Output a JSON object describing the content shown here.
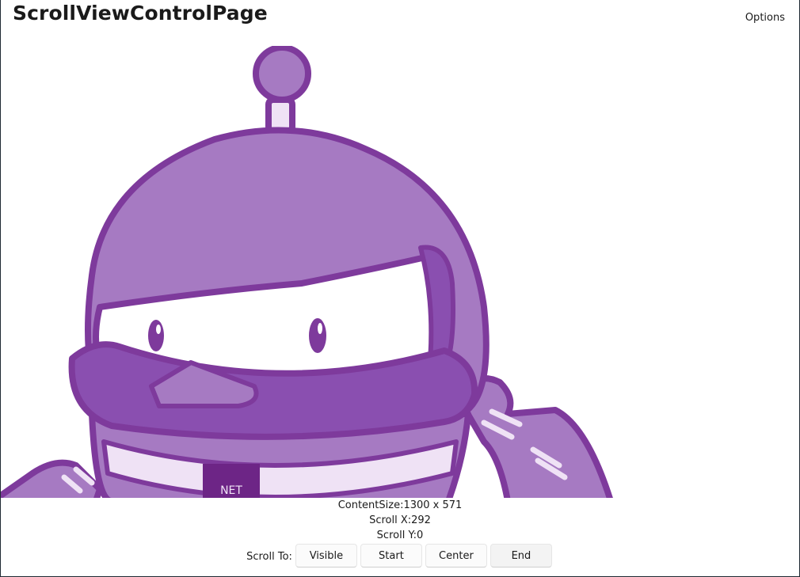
{
  "header": {
    "title": "ScrollViewControlPage",
    "options_label": "Options"
  },
  "content": {
    "image": "dotnet-bot-mascot",
    "badge_text": "NET",
    "colors": {
      "primary": "#a67ac2",
      "outline": "#7e3a9c",
      "light": "#efe2f5",
      "dark": "#6d2586"
    }
  },
  "info": {
    "content_size": "ContentSize:1300 x 571",
    "scroll_x": "Scroll X:292",
    "scroll_y": "Scroll Y:0"
  },
  "scroll_to": {
    "label": "Scroll To:",
    "buttons": [
      "Visible",
      "Start",
      "Center",
      "End"
    ]
  }
}
